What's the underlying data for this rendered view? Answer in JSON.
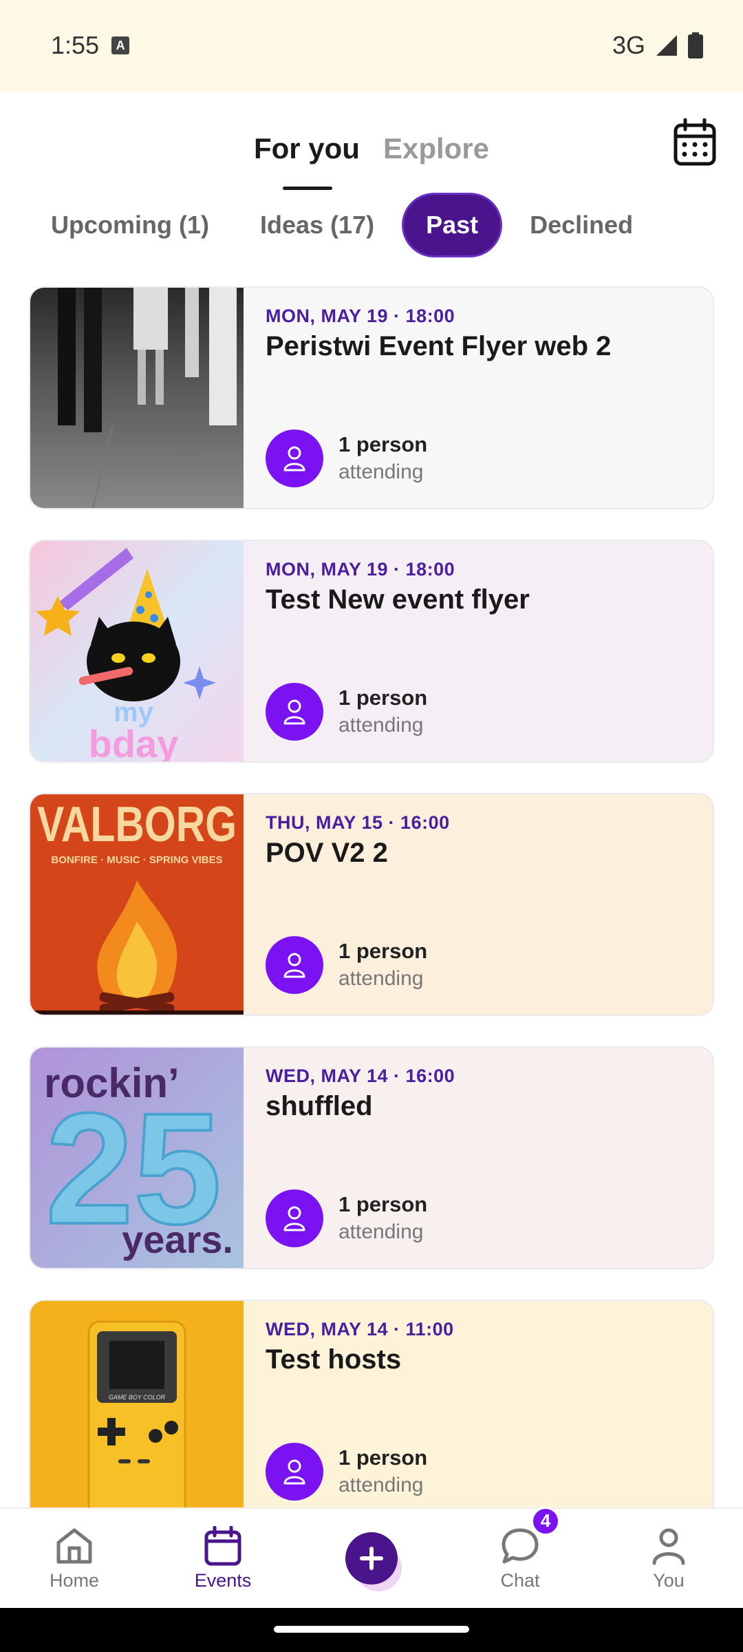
{
  "status_bar": {
    "time": "1:55",
    "network": "3G"
  },
  "header": {
    "tabs": [
      {
        "label": "For you",
        "active": true
      },
      {
        "label": "Explore",
        "active": false
      }
    ],
    "calendar_icon": "calendar-icon"
  },
  "filters": [
    {
      "label": "Upcoming (1)",
      "active": false
    },
    {
      "label": "Ideas (17)",
      "active": false
    },
    {
      "label": "Past",
      "active": true
    },
    {
      "label": "Declined",
      "active": false
    }
  ],
  "events": [
    {
      "date": "MON, MAY 19 · 18:00",
      "title": "Peristwi Event Flyer web 2",
      "count": "1 person",
      "label": "attending",
      "bg": "#f7f7f7"
    },
    {
      "date": "MON, MAY 19 · 18:00",
      "title": "Test New event flyer",
      "count": "1 person",
      "label": "attending",
      "bg": "#f5eff5"
    },
    {
      "date": "THU, MAY 15 · 16:00",
      "title": "POV V2 2",
      "count": "1 person",
      "label": "attending",
      "bg": "#fcefdc"
    },
    {
      "date": "WED, MAY 14 · 16:00",
      "title": "shuffled",
      "count": "1 person",
      "label": "attending",
      "bg": "#f8efef"
    },
    {
      "date": "WED, MAY 14 · 11:00",
      "title": "Test hosts",
      "count": "1 person",
      "label": "attending",
      "bg": "#fcf3d8"
    }
  ],
  "thumbnails": {
    "valborg_title": "VALBORG",
    "valborg_sub": "BONFIRE · MUSIC · SPRING VIBES",
    "bday_text1": "my",
    "bday_text2": "bday",
    "rockin_text1": "rockin’",
    "rockin_text2": "25",
    "rockin_text3": "years.",
    "gameboy_text": "GAME BOY COLOR"
  },
  "nav": {
    "items": [
      {
        "label": "Home",
        "active": false
      },
      {
        "label": "Events",
        "active": true
      },
      {
        "label": "",
        "active": false
      },
      {
        "label": "Chat",
        "active": false
      },
      {
        "label": "You",
        "active": false
      }
    ],
    "chat_badge": "4"
  },
  "colors": {
    "accent": "#4a148c",
    "avatar": "#7b12f2"
  }
}
